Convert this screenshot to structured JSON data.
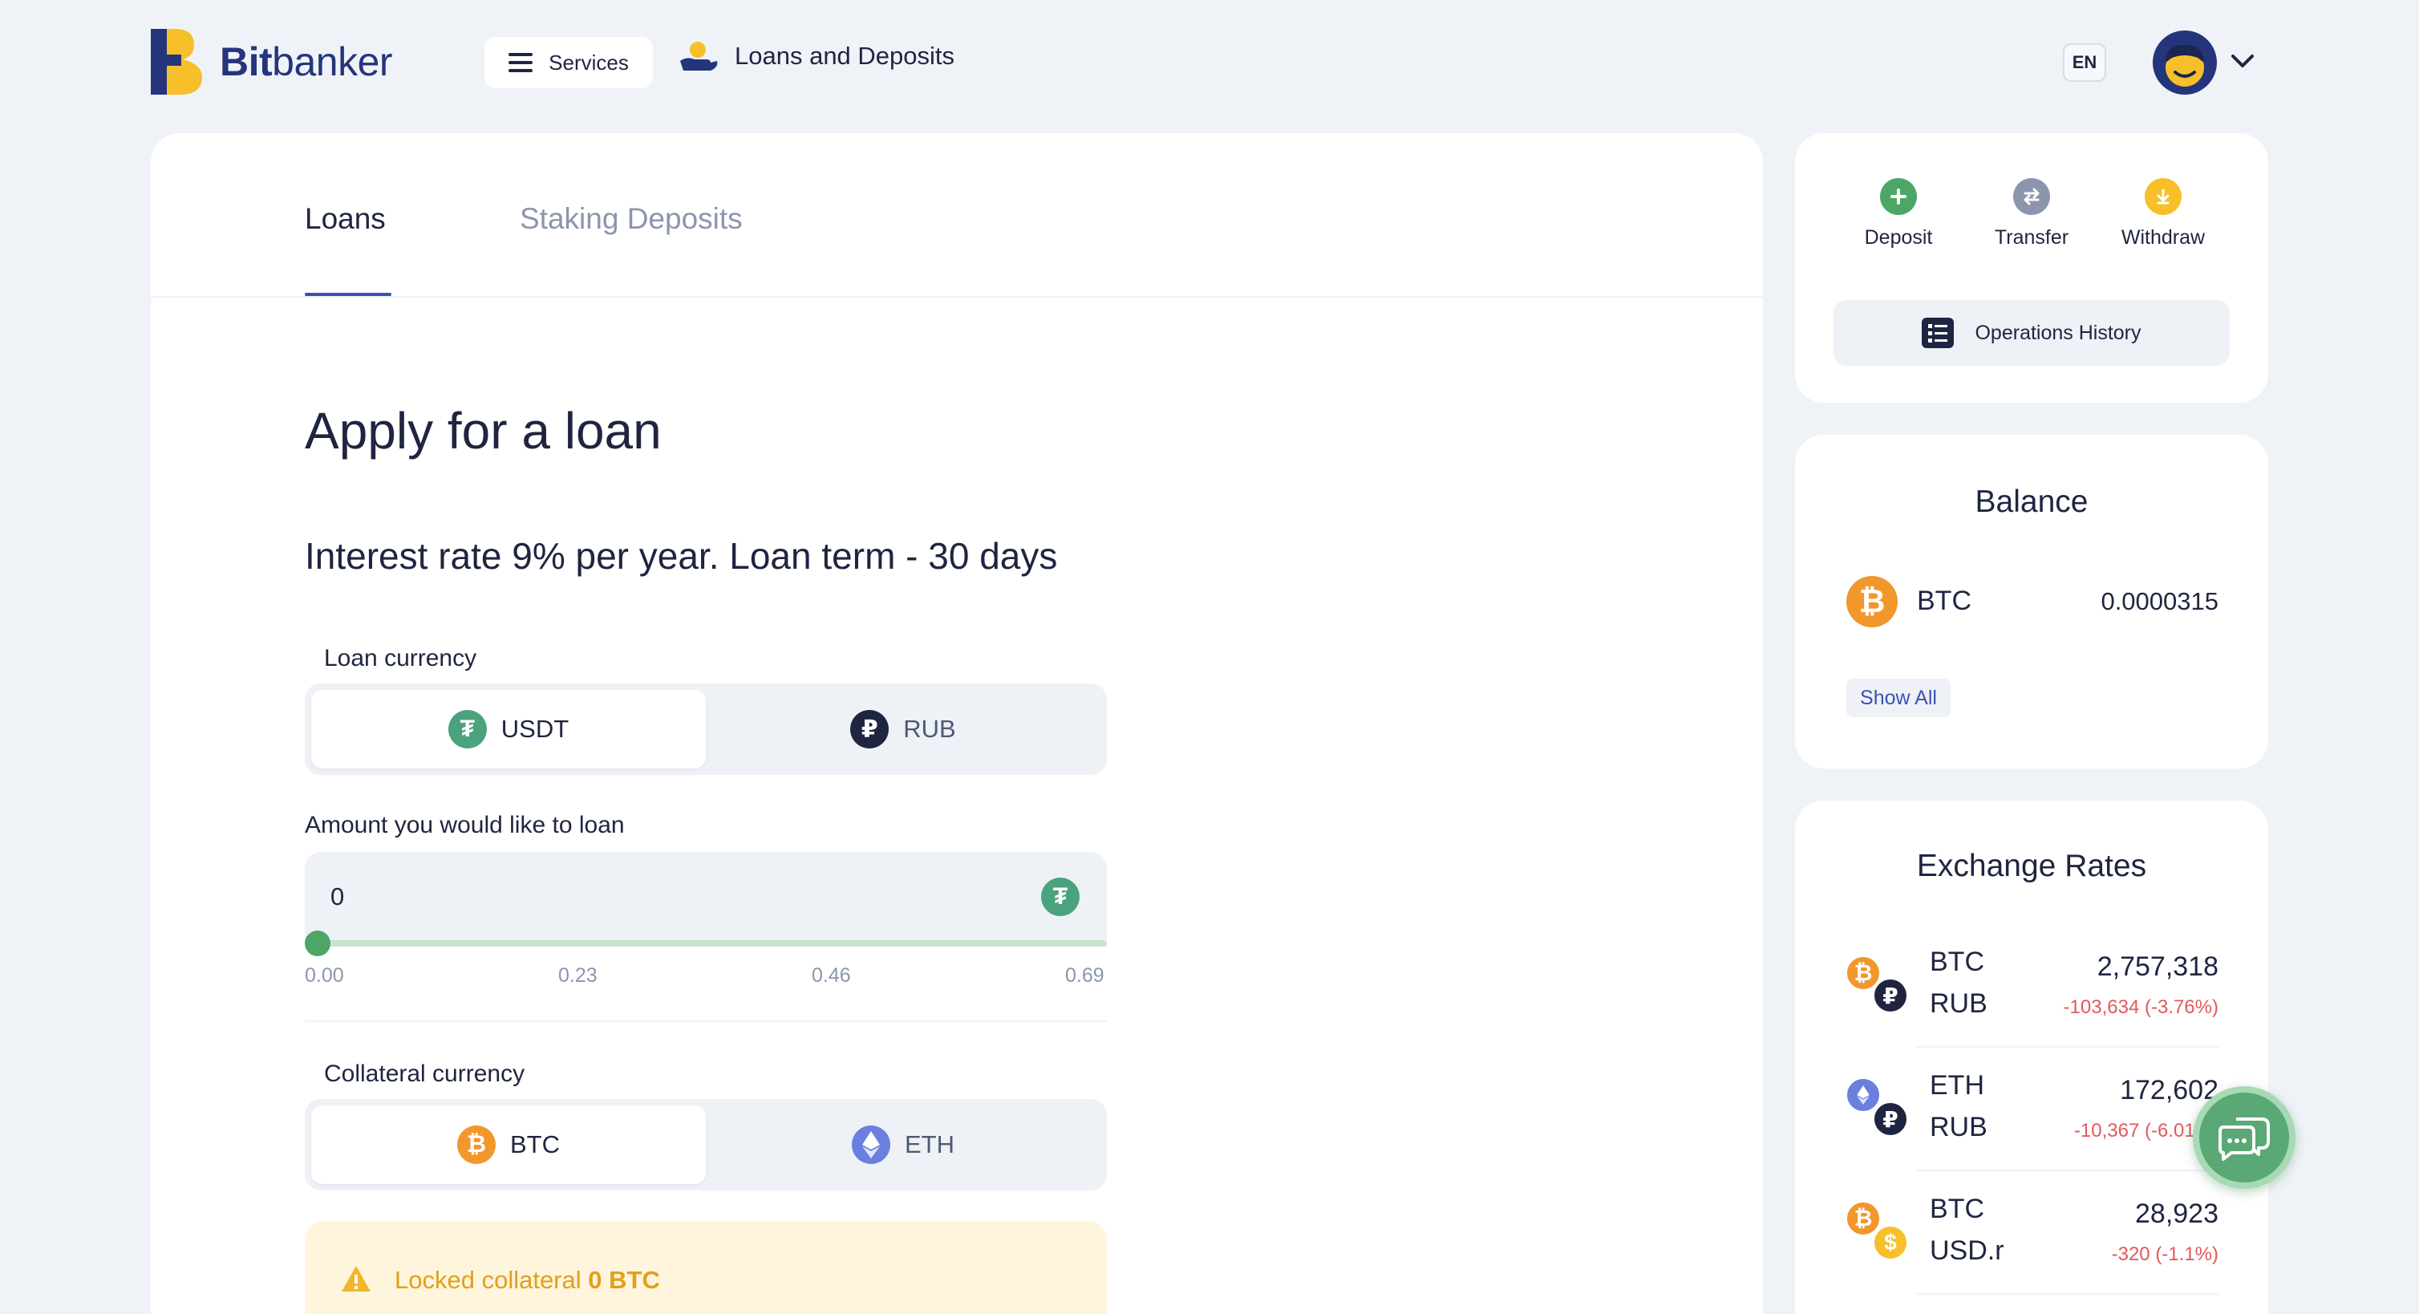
{
  "header": {
    "logo_bold": "Bit",
    "logo_rest": "banker",
    "services_label": "Services",
    "nav_loans_label": "Loans and Deposits",
    "lang": "EN"
  },
  "tabs": [
    {
      "label": "Loans",
      "active": true
    },
    {
      "label": "Staking Deposits",
      "active": false
    }
  ],
  "form": {
    "title": "Apply for a loan",
    "subtitle": "Interest rate 9% per year. Loan term - 30 days",
    "loan_currency_label": "Loan currency",
    "loan_currency_options": [
      {
        "label": "USDT",
        "icon": "tether-icon",
        "selected": true
      },
      {
        "label": "RUB",
        "icon": "ruble-icon",
        "selected": false
      }
    ],
    "amount_label": "Amount you would like to loan",
    "amount_value": "0",
    "slider_position": 0,
    "slider_ticks": [
      "0.00",
      "0.23",
      "0.46",
      "0.69"
    ],
    "collateral_label": "Collateral currency",
    "collateral_options": [
      {
        "label": "BTC",
        "icon": "bitcoin-icon",
        "selected": true
      },
      {
        "label": "ETH",
        "icon": "ethereum-icon",
        "selected": false
      }
    ],
    "locked_prefix": "Locked collateral",
    "locked_value": "0 BTC"
  },
  "actions": {
    "deposit": "Deposit",
    "transfer": "Transfer",
    "withdraw": "Withdraw",
    "operations_history": "Operations History"
  },
  "balance": {
    "title": "Balance",
    "items": [
      {
        "currency": "BTC",
        "amount": "0.0000315",
        "icon": "bitcoin-icon"
      }
    ],
    "show_all": "Show All"
  },
  "rates": {
    "title": "Exchange Rates",
    "items": [
      {
        "base": "BTC",
        "quote": "RUB",
        "value": "2,757,318",
        "change": "-103,634 (-3.76%)"
      },
      {
        "base": "ETH",
        "quote": "RUB",
        "value": "172,602",
        "change": "-10,367 (-6.01%)"
      },
      {
        "base": "BTC",
        "quote": "USD.r",
        "value": "28,923",
        "change": "-320 (-1.1%)"
      }
    ]
  },
  "colors": {
    "brand": "#24357c",
    "accent_blue": "#3a51b5",
    "bitcoin": "#f2972c",
    "tether": "#4aa37d",
    "ethereum": "#6a7fe0",
    "negative": "#e4575a",
    "warning": "#e0a01d"
  }
}
